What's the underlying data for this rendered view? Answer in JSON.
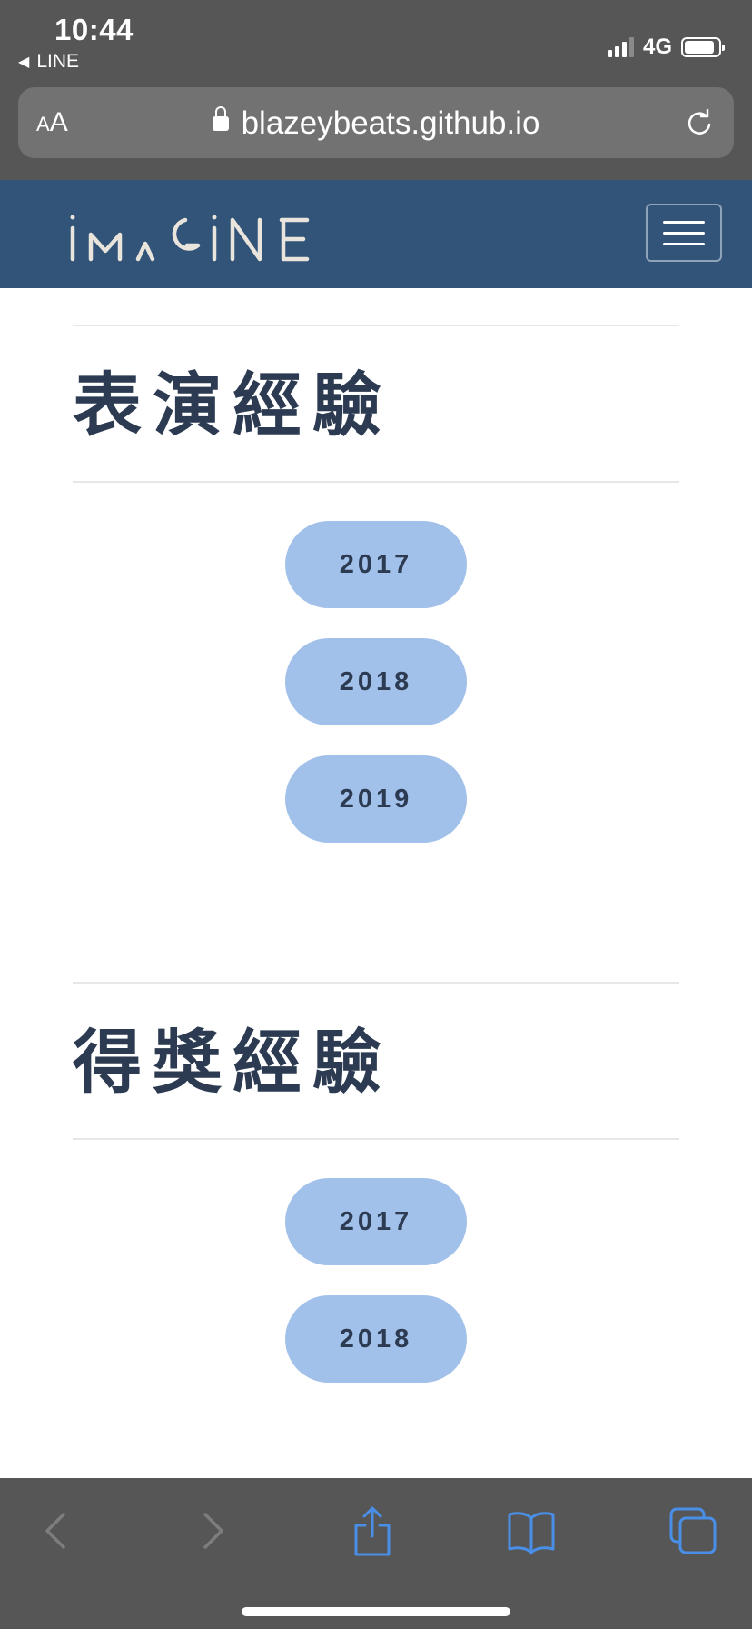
{
  "status_bar": {
    "time": "10:44",
    "back_app": "LINE",
    "network": "4G",
    "signal_bars": 3,
    "signal_bars_total": 4,
    "battery_level": 0.85
  },
  "address_bar": {
    "text_size_label": "AA",
    "url": "blazeybeats.github.io",
    "lock_icon": "lock-icon",
    "reload_icon": "reload-icon"
  },
  "navbar": {
    "logo_text": "IMAGINE",
    "menu_icon": "hamburger-icon"
  },
  "sections": [
    {
      "title": "表演經驗",
      "years": [
        "2017",
        "2018",
        "2019"
      ]
    },
    {
      "title": "得獎經驗",
      "years": [
        "2017",
        "2018"
      ]
    }
  ],
  "toolbar": {
    "icons": [
      "back-arrow-icon",
      "forward-arrow-icon",
      "share-icon",
      "bookmarks-icon",
      "tabs-icon"
    ]
  },
  "colors": {
    "navbar": "#315478",
    "button": "#a2c1ea",
    "title_text": "#2c3b52",
    "browser_chrome": "#565656",
    "toolbar_active_icon": "#4a8fe7"
  }
}
